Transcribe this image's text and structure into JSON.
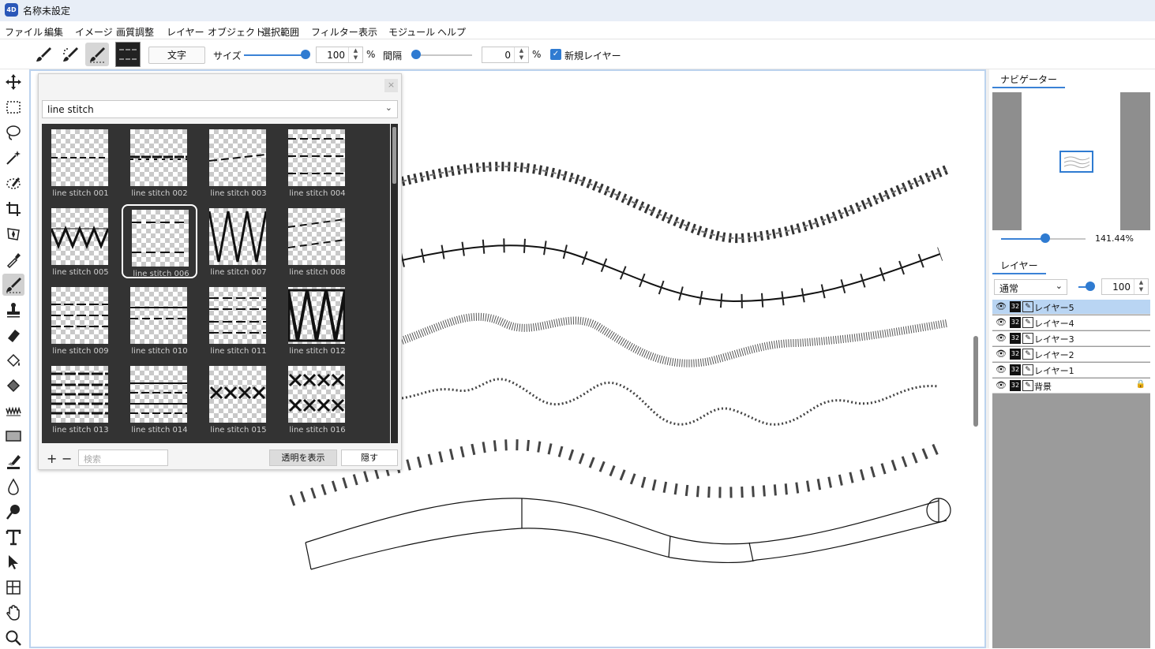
{
  "app": {
    "title": "名称未設定",
    "icon_label": "4D"
  },
  "menu": [
    "ファイル",
    "編集",
    "イメージ",
    "画質調整",
    "レイヤー",
    "オブジェクト",
    "選択範囲",
    "フィルター",
    "表示",
    "モジュール",
    "ヘルプ"
  ],
  "toolbar": {
    "text_button": "文字",
    "size_label": "サイズ",
    "size_value": "100",
    "size_unit": "%",
    "size_slider": 1.0,
    "spacing_label": "間隔",
    "spacing_value": "0",
    "spacing_unit": "%",
    "spacing_slider": 0.0,
    "new_layer_label": "新規レイヤー",
    "new_layer_checked": true
  },
  "brush_panel": {
    "close_label": "×",
    "category": "line stitch",
    "selected": "line stitch 006",
    "brushes": [
      {
        "label": "line stitch 001",
        "pattern": "dash"
      },
      {
        "label": "line stitch 002",
        "pattern": "double"
      },
      {
        "label": "line stitch 003",
        "pattern": "slant"
      },
      {
        "label": "line stitch 004",
        "pattern": "dash3"
      },
      {
        "label": "line stitch 005",
        "pattern": "zig"
      },
      {
        "label": "line stitch 006",
        "pattern": "dash2"
      },
      {
        "label": "line stitch 007",
        "pattern": "zigtall"
      },
      {
        "label": "line stitch 008",
        "pattern": "slant3"
      },
      {
        "label": "line stitch 009",
        "pattern": "dash3b"
      },
      {
        "label": "line stitch 010",
        "pattern": "solid-dash"
      },
      {
        "label": "line stitch 011",
        "pattern": "dash4"
      },
      {
        "label": "line stitch 012",
        "pattern": "zigbox"
      },
      {
        "label": "line stitch 013",
        "pattern": "heavy"
      },
      {
        "label": "line stitch 014",
        "pattern": "solid2"
      },
      {
        "label": "line stitch 015",
        "pattern": "xx"
      },
      {
        "label": "line stitch 016",
        "pattern": "xx2"
      }
    ],
    "add_label": "+",
    "remove_label": "−",
    "search_placeholder": "検索",
    "show_transparent_label": "透明を表示",
    "hide_label": "隠す"
  },
  "navigator": {
    "tab": "ナビゲーター",
    "zoom": "141.44%",
    "zoom_slider": 0.52
  },
  "layers_panel": {
    "tab": "レイヤー",
    "blend_mode": "通常",
    "opacity": "100",
    "opacity_slider": 1.0,
    "layers": [
      {
        "name": "レイヤー5",
        "depth": "32",
        "selected": true,
        "locked": false
      },
      {
        "name": "レイヤー4",
        "depth": "32",
        "selected": false,
        "locked": false
      },
      {
        "name": "レイヤー3",
        "depth": "32",
        "selected": false,
        "locked": false
      },
      {
        "name": "レイヤー2",
        "depth": "32",
        "selected": false,
        "locked": false
      },
      {
        "name": "レイヤー1",
        "depth": "32",
        "selected": false,
        "locked": false
      },
      {
        "name": "背景",
        "depth": "32",
        "selected": false,
        "locked": true
      }
    ]
  },
  "tools": [
    "move-icon",
    "rect-select-icon",
    "lasso-icon",
    "magic-wand-icon",
    "pen-select-icon",
    "crop-icon",
    "transform-icon",
    "eyedropper-icon",
    "brush-icon",
    "stamp-icon",
    "eraser-icon",
    "fill-icon",
    "gradient-fill-icon",
    "wave-icon",
    "rectangle-icon",
    "paint-icon",
    "drop-icon",
    "smudge-icon",
    "text-icon",
    "arrow-icon",
    "mesh-icon",
    "hand-icon",
    "zoom-icon"
  ],
  "colors": {
    "accent": "#2f7bd1",
    "selection": "#b9d5f3",
    "panel_dark": "#333333"
  }
}
